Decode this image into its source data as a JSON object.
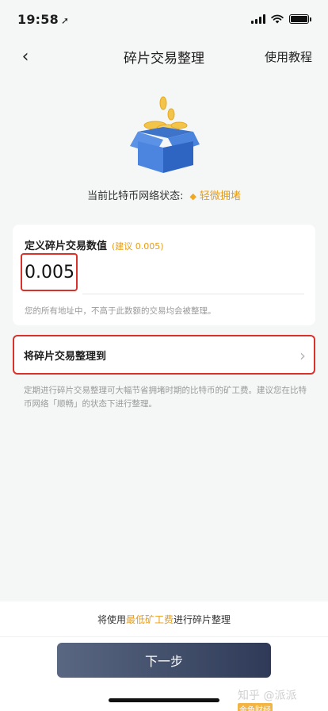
{
  "status_bar": {
    "time": "19:58",
    "location_icon": "location-arrow-icon",
    "signal_icon": "cellular-signal-icon",
    "wifi_icon": "wifi-icon",
    "battery_icon": "battery-icon"
  },
  "nav": {
    "back_icon": "chevron-left-icon",
    "back_glyph": "‹",
    "title": "碎片交易整理",
    "right_label": "使用教程"
  },
  "hero": {
    "icon": "coin-box-illustration"
  },
  "network_status": {
    "label": "当前比特币网络状态:",
    "indicator_icon": "diamond-icon",
    "indicator_glyph": "◆",
    "value": "轻微拥堵",
    "value_color": "#e89c16"
  },
  "define_card": {
    "title": "定义碎片交易数值",
    "hint": "(建议 0.005)",
    "amount_value": "0.005",
    "note": "您的所有地址中，不高于此数额的交易均会被整理。"
  },
  "target_card": {
    "label": "将碎片交易整理到",
    "chevron_glyph": "›"
  },
  "description": "定期进行碎片交易整理可大幅节省拥堵时期的比特币的矿工费。建议您在比特币网络「顺畅」的状态下进行整理。",
  "bottom": {
    "fee_prefix": "将使用",
    "fee_highlight": "最低矿工费",
    "fee_suffix": "进行碎片整理",
    "next_label": "下一步"
  },
  "watermark": {
    "text": "知乎 @派派",
    "badge": "金色财经"
  },
  "colors": {
    "accent_orange": "#e89c16",
    "highlight_red": "#d9322d",
    "button_dark": "#2e3a57",
    "background": "#f4f7f6"
  }
}
